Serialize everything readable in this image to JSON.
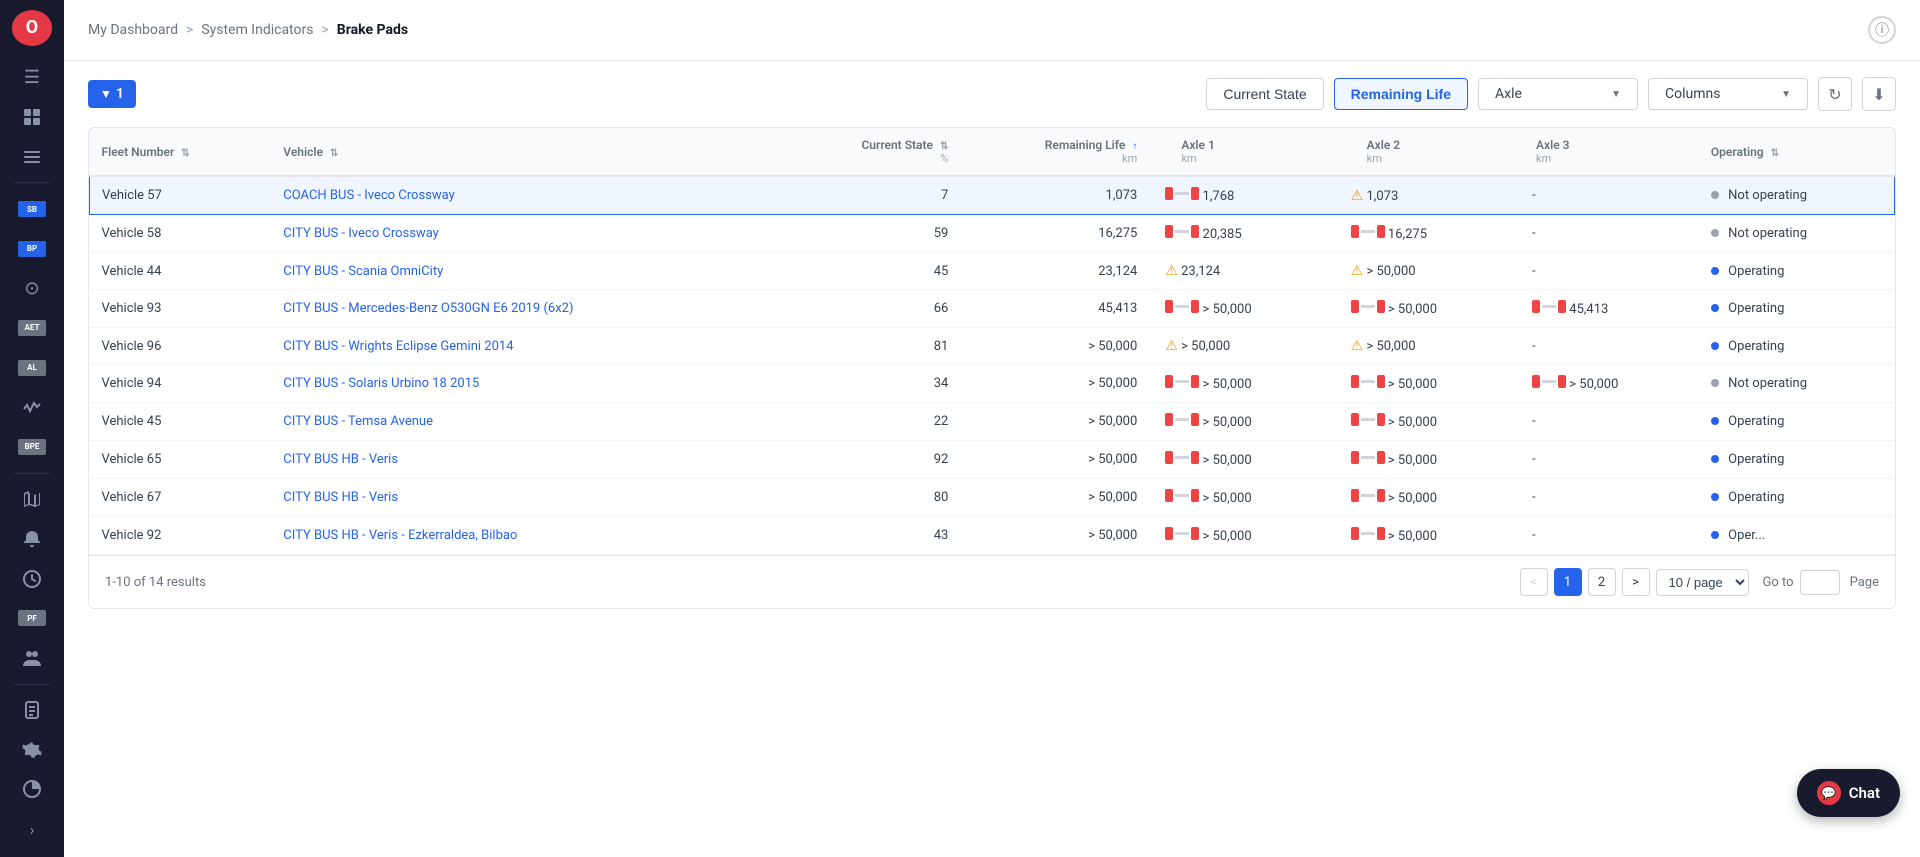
{
  "sidebar": {
    "logo": "O",
    "items": [
      {
        "name": "menu-toggle",
        "icon": "☰",
        "interactable": true
      },
      {
        "name": "dashboard",
        "icon": "⊞",
        "interactable": true
      },
      {
        "name": "list-view",
        "icon": "☰",
        "interactable": true
      },
      {
        "name": "separator1",
        "type": "divider"
      },
      {
        "name": "sb-label",
        "label": "SB",
        "interactable": false
      },
      {
        "name": "bp-label",
        "label": "BP",
        "interactable": false
      },
      {
        "name": "circle-indicator",
        "icon": "⊙",
        "interactable": true
      },
      {
        "name": "aet-label",
        "label": "AET",
        "interactable": false
      },
      {
        "name": "al-label",
        "label": "AL",
        "interactable": false
      },
      {
        "name": "activity",
        "icon": "〜",
        "interactable": true
      },
      {
        "name": "bpe-label",
        "label": "BPE",
        "interactable": false
      },
      {
        "name": "separator2",
        "type": "divider"
      },
      {
        "name": "map",
        "icon": "🗺",
        "interactable": true
      },
      {
        "name": "bell",
        "icon": "🔔",
        "interactable": true
      },
      {
        "name": "clock",
        "icon": "🕐",
        "interactable": true
      },
      {
        "name": "pf-label",
        "label": "PF",
        "interactable": false
      },
      {
        "name": "people",
        "icon": "👥",
        "interactable": true
      },
      {
        "name": "separator3",
        "type": "divider"
      },
      {
        "name": "docs",
        "icon": "📄",
        "interactable": true
      },
      {
        "name": "settings",
        "icon": "⚙",
        "interactable": true
      },
      {
        "name": "pie-chart",
        "icon": "◔",
        "interactable": true
      }
    ],
    "expand": "›"
  },
  "breadcrumb": {
    "items": [
      "My Dashboard",
      "System Indicators",
      "Brake Pads"
    ],
    "separators": [
      ">",
      ">"
    ]
  },
  "toolbar": {
    "filter_count": "1",
    "current_state_label": "Current State",
    "remaining_life_label": "Remaining Life",
    "axle_dropdown_label": "Axle",
    "columns_label": "Columns",
    "refresh_icon": "↻",
    "download_icon": "⬇"
  },
  "table": {
    "columns": [
      {
        "key": "fleet_number",
        "label": "Fleet Number",
        "sortable": true
      },
      {
        "key": "vehicle",
        "label": "Vehicle",
        "sortable": true
      },
      {
        "key": "current_state",
        "label": "Current State",
        "unit": "%",
        "sortable": true
      },
      {
        "key": "remaining_life",
        "label": "Remaining Life",
        "unit": "km",
        "sortable": true,
        "sort_dir": "asc"
      },
      {
        "key": "axle1",
        "label": "Axle 1",
        "unit": "km"
      },
      {
        "key": "axle2",
        "label": "Axle 2",
        "unit": "km"
      },
      {
        "key": "axle3",
        "label": "Axle 3",
        "unit": "km"
      },
      {
        "key": "operating",
        "label": "Operating",
        "sortable": true
      }
    ],
    "rows": [
      {
        "fleet_number": "Vehicle 57",
        "vehicle": "COACH BUS - Iveco Crossway",
        "current_state": "7",
        "remaining_life": "1,073",
        "axle1_value": "1,768",
        "axle1_icon": "critical",
        "axle2_value": "1,073",
        "axle2_icon": "warning",
        "axle3_value": "-",
        "axle3_icon": "",
        "operating": "Not operating",
        "operating_status": "not-operating",
        "selected": true
      },
      {
        "fleet_number": "Vehicle 58",
        "vehicle": "CITY BUS - Iveco Crossway",
        "current_state": "59",
        "remaining_life": "16,275",
        "axle1_value": "20,385",
        "axle1_icon": "critical",
        "axle2_value": "16,275",
        "axle2_icon": "critical",
        "axle3_value": "-",
        "axle3_icon": "",
        "operating": "Not operating",
        "operating_status": "not-operating",
        "selected": false
      },
      {
        "fleet_number": "Vehicle 44",
        "vehicle": "CITY BUS - Scania OmniCity",
        "current_state": "45",
        "remaining_life": "23,124",
        "axle1_value": "23,124",
        "axle1_icon": "warning",
        "axle2_value": "> 50,000",
        "axle2_icon": "warning",
        "axle3_value": "-",
        "axle3_icon": "",
        "operating": "Operating",
        "operating_status": "operating",
        "selected": false
      },
      {
        "fleet_number": "Vehicle 93",
        "vehicle": "CITY BUS - Mercedes-Benz O530GN E6 2019 (6x2)",
        "current_state": "66",
        "remaining_life": "45,413",
        "axle1_value": "> 50,000",
        "axle1_icon": "critical",
        "axle2_value": "> 50,000",
        "axle2_icon": "critical",
        "axle3_value": "45,413",
        "axle3_icon": "critical",
        "operating": "Operating",
        "operating_status": "operating",
        "selected": false
      },
      {
        "fleet_number": "Vehicle 96",
        "vehicle": "CITY BUS - Wrights Eclipse Gemini 2014",
        "current_state": "81",
        "remaining_life": "> 50,000",
        "axle1_value": "> 50,000",
        "axle1_icon": "warning",
        "axle2_value": "> 50,000",
        "axle2_icon": "warning",
        "axle3_value": "-",
        "axle3_icon": "",
        "operating": "Operating",
        "operating_status": "operating",
        "selected": false
      },
      {
        "fleet_number": "Vehicle 94",
        "vehicle": "CITY BUS - Solaris Urbino 18 2015",
        "current_state": "34",
        "remaining_life": "> 50,000",
        "axle1_value": "> 50,000",
        "axle1_icon": "critical",
        "axle2_value": "> 50,000",
        "axle2_icon": "critical",
        "axle3_value": "> 50,000",
        "axle3_icon": "critical",
        "operating": "Not operating",
        "operating_status": "not-operating",
        "selected": false
      },
      {
        "fleet_number": "Vehicle 45",
        "vehicle": "CITY BUS - Temsa Avenue",
        "current_state": "22",
        "remaining_life": "> 50,000",
        "axle1_value": "> 50,000",
        "axle1_icon": "critical",
        "axle2_value": "> 50,000",
        "axle2_icon": "critical",
        "axle3_value": "-",
        "axle3_icon": "",
        "operating": "Operating",
        "operating_status": "operating",
        "selected": false
      },
      {
        "fleet_number": "Vehicle 65",
        "vehicle": "CITY BUS HB - Veris",
        "current_state": "92",
        "remaining_life": "> 50,000",
        "axle1_value": "> 50,000",
        "axle1_icon": "critical",
        "axle2_value": "> 50,000",
        "axle2_icon": "critical",
        "axle3_value": "-",
        "axle3_icon": "",
        "operating": "Operating",
        "operating_status": "operating",
        "selected": false
      },
      {
        "fleet_number": "Vehicle 67",
        "vehicle": "CITY BUS HB - Veris",
        "current_state": "80",
        "remaining_life": "> 50,000",
        "axle1_value": "> 50,000",
        "axle1_icon": "critical",
        "axle2_value": "> 50,000",
        "axle2_icon": "critical",
        "axle3_value": "-",
        "axle3_icon": "",
        "operating": "Operating",
        "operating_status": "operating",
        "selected": false
      },
      {
        "fleet_number": "Vehicle 92",
        "vehicle": "CITY BUS HB - Veris - Ezkerraldea, Bilbao",
        "current_state": "43",
        "remaining_life": "> 50,000",
        "axle1_value": "> 50,000",
        "axle1_icon": "critical",
        "axle2_value": "> 50,000",
        "axle2_icon": "critical",
        "axle3_value": "-",
        "axle3_icon": "",
        "operating": "Oper...",
        "operating_status": "operating",
        "selected": false
      }
    ]
  },
  "pagination": {
    "results_text": "1-10 of 14 results",
    "current_page": 1,
    "total_pages": 2,
    "per_page": "10 / page",
    "goto_label": "Go to",
    "page_label": "Page"
  },
  "chat": {
    "label": "Chat"
  }
}
